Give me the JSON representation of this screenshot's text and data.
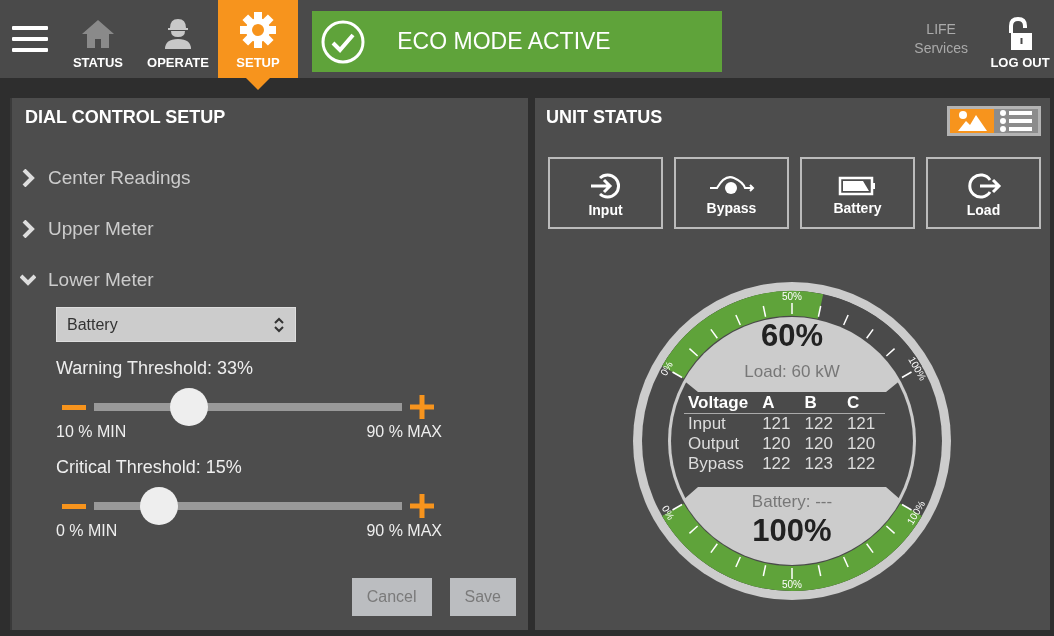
{
  "nav": {
    "tabs": [
      {
        "kind": "home",
        "label": "STATUS",
        "selected": false
      },
      {
        "kind": "worker",
        "label": "OPERATE",
        "selected": false
      },
      {
        "kind": "gear",
        "label": "SETUP",
        "selected": true
      }
    ],
    "banner": "ECO MODE ACTIVE",
    "brand": [
      "LIFE",
      "Services"
    ],
    "logout": "LOG OUT"
  },
  "dial_setup": {
    "title": "DIAL CONTROL SETUP",
    "sections": [
      {
        "label": "Center Readings",
        "expanded": false
      },
      {
        "label": "Upper Meter",
        "expanded": false
      },
      {
        "label": "Lower Meter",
        "expanded": true
      }
    ],
    "select": "Battery",
    "sliders": [
      {
        "label": "Warning Threshold: 33%",
        "level": 0.31,
        "min": "10 % MIN",
        "max": "90 % MAX"
      },
      {
        "label": "Critical Threshold: 15%",
        "level": 0.21,
        "min": "0 % MIN",
        "max": "90 % MAX"
      }
    ],
    "buttons": [
      {
        "label": "Cancel",
        "disabled": true
      },
      {
        "label": "Save",
        "disabled": true
      }
    ]
  },
  "unit_status": {
    "title": "UNIT STATUS",
    "views": [
      {
        "kind": "graphic",
        "selected": true
      },
      {
        "kind": "list",
        "selected": false
      }
    ],
    "tiles": [
      {
        "kind": "input",
        "label": "Input"
      },
      {
        "kind": "bypass",
        "label": "Bypass"
      },
      {
        "kind": "battery",
        "label": "Battery"
      },
      {
        "kind": "load",
        "label": "Load"
      }
    ],
    "gauge": {
      "upper": {
        "value": "60%",
        "caption": "Load: 60 kW",
        "level": 0.6,
        "ticks": [
          "0%",
          "50%",
          "100%"
        ]
      },
      "table": {
        "columns": [
          "Voltage",
          "A",
          "B",
          "C"
        ],
        "rows": [
          [
            "Input",
            "121",
            "122",
            "121"
          ],
          [
            "Output",
            "120",
            "120",
            "120"
          ],
          [
            "Bypass",
            "122",
            "123",
            "122"
          ]
        ]
      },
      "lower": {
        "caption": "Battery: ---",
        "value": "100%",
        "level": 1,
        "ticks": [
          "0%",
          "50%",
          "100%"
        ]
      }
    }
  }
}
